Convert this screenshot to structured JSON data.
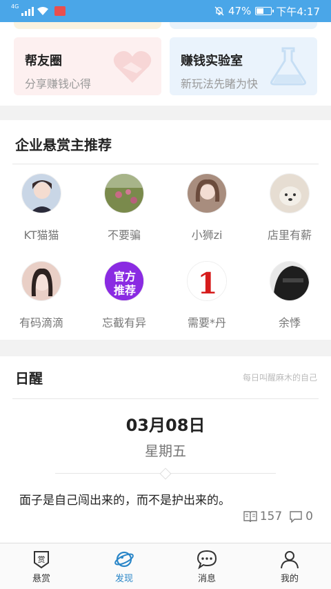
{
  "status_bar": {
    "network": "4G",
    "battery": "47%",
    "time": "下午4:17"
  },
  "cards": [
    {
      "title": "帮友圈",
      "subtitle": "分享赚钱心得",
      "icon": "handshake-heart-icon",
      "bg": "#fdf0f0"
    },
    {
      "title": "赚钱实验室",
      "subtitle": "新玩法先睹为快",
      "icon": "flask-icon",
      "bg": "#eaf3fc"
    }
  ],
  "recommend": {
    "title": "企业悬赏主推荐",
    "users": [
      {
        "name": "KT猫猫",
        "avatar_color": "#c9d6e6"
      },
      {
        "name": "不要骗",
        "avatar_color": "#7a8a4c"
      },
      {
        "name": "小狮zi",
        "avatar_color": "#a88d7e"
      },
      {
        "name": "店里有薪",
        "avatar_color": "#e6ddd2"
      },
      {
        "name": "有码滴滴",
        "avatar_color": "#e9cfc6"
      },
      {
        "name": "忘截有异",
        "avatar_color": "#8a2be2",
        "avatar_text": "官方推荐"
      },
      {
        "name": "需要*丹",
        "avatar_color": "#ffffff",
        "avatar_text": "1"
      },
      {
        "name": "余悸",
        "avatar_color": "#444444"
      }
    ]
  },
  "daily": {
    "title": "日醒",
    "subtitle": "每日叫醒麻木的自己",
    "date": "03月08日",
    "weekday": "星期五",
    "quote": "面子是自己闯出来的，而不是护出来的。",
    "reads": "157",
    "comments": "0"
  },
  "nav": [
    {
      "label": "悬赏",
      "icon": "reward-icon",
      "active": false
    },
    {
      "label": "发现",
      "icon": "planet-icon",
      "active": true
    },
    {
      "label": "消息",
      "icon": "chat-bubble-icon",
      "active": false
    },
    {
      "label": "我的",
      "icon": "person-icon",
      "active": false
    }
  ],
  "colors": {
    "accent": "#2a86c8",
    "status_bar": "#4aa6e8"
  }
}
